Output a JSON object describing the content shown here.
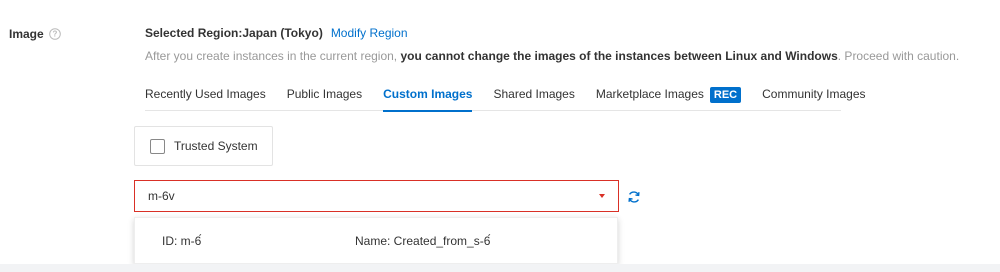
{
  "field": {
    "label": "Image",
    "help_icon": "question-circle-icon"
  },
  "region": {
    "selected_text": "Selected Region:Japan (Tokyo)",
    "modify_link": "Modify Region"
  },
  "caution": {
    "prefix": "After you create instances in the current region, ",
    "bold": "you cannot change the images of the instances between Linux and Windows",
    "suffix": ". Proceed with caution."
  },
  "tabs": [
    {
      "label": "Recently Used Images",
      "active": false
    },
    {
      "label": "Public Images",
      "active": false
    },
    {
      "label": "Custom Images",
      "active": true
    },
    {
      "label": "Shared Images",
      "active": false
    },
    {
      "label": "Marketplace Images",
      "active": false,
      "badge": "REC"
    },
    {
      "label": "Community Images",
      "active": false
    }
  ],
  "trusted": {
    "label": "Trusted System",
    "checked": false
  },
  "search": {
    "value": "m-6v",
    "caret_icon": "caret-down-icon",
    "refresh_icon": "refresh-icon"
  },
  "dropdown": {
    "option": {
      "id_text": "ID:  m-6́",
      "name_text": "Name:  Created_from_s-6́"
    }
  },
  "colors": {
    "accent": "#0070cc",
    "error": "#d93026",
    "muted": "#999999"
  }
}
